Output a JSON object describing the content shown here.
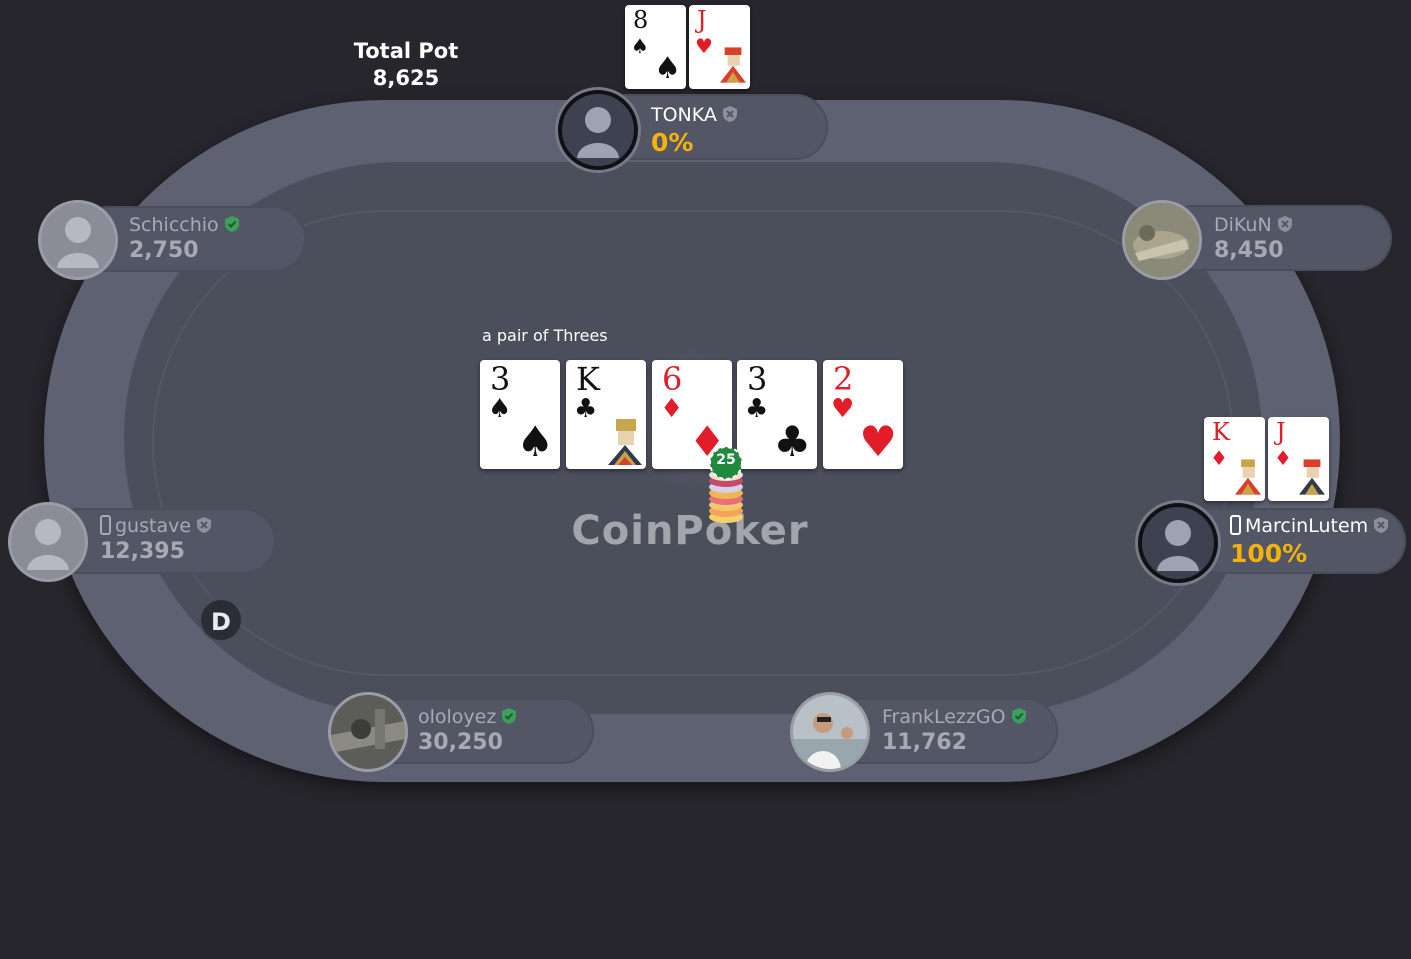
{
  "pot": {
    "label": "Total Pot",
    "amount": "8,625"
  },
  "hand_description": "a pair of Threes",
  "watermark": "CoinPoker",
  "dealer_button": "D",
  "board_chip": "25",
  "board": [
    {
      "rank": "3",
      "suit": "♠",
      "color": "black"
    },
    {
      "rank": "K",
      "suit": "♣",
      "color": "black"
    },
    {
      "rank": "6",
      "suit": "♦",
      "color": "red"
    },
    {
      "rank": "3",
      "suit": "♣",
      "color": "black"
    },
    {
      "rank": "2",
      "suit": "♥",
      "color": "red"
    }
  ],
  "players": {
    "tonka": {
      "name": "TONKA",
      "value": "0%",
      "verified": false,
      "cards": [
        {
          "rank": "8",
          "suit": "♠"
        },
        {
          "rank": "J",
          "suit": "♥"
        }
      ]
    },
    "schicchio": {
      "name": "Schicchio",
      "value": "2,750",
      "verified": true
    },
    "dikun": {
      "name": "DiKuN",
      "value": "8,450",
      "verified": false
    },
    "gustave": {
      "name": "gustave",
      "value": "12,395",
      "verified": false
    },
    "marcinlutem": {
      "name": "MarcinLutem",
      "value": "100%",
      "verified": false,
      "cards": [
        {
          "rank": "K",
          "suit": "♦"
        },
        {
          "rank": "J",
          "suit": "♦"
        }
      ]
    },
    "ololoyez": {
      "name": "ololoyez",
      "value": "30,250",
      "verified": true
    },
    "franklezzgo": {
      "name": "FrankLezzGO",
      "value": "11,762",
      "verified": true
    }
  },
  "colors": {
    "pct_highlight": "#f3b20c",
    "verified_green": "#3aa05a",
    "unverified_grey": "#8d909a"
  }
}
